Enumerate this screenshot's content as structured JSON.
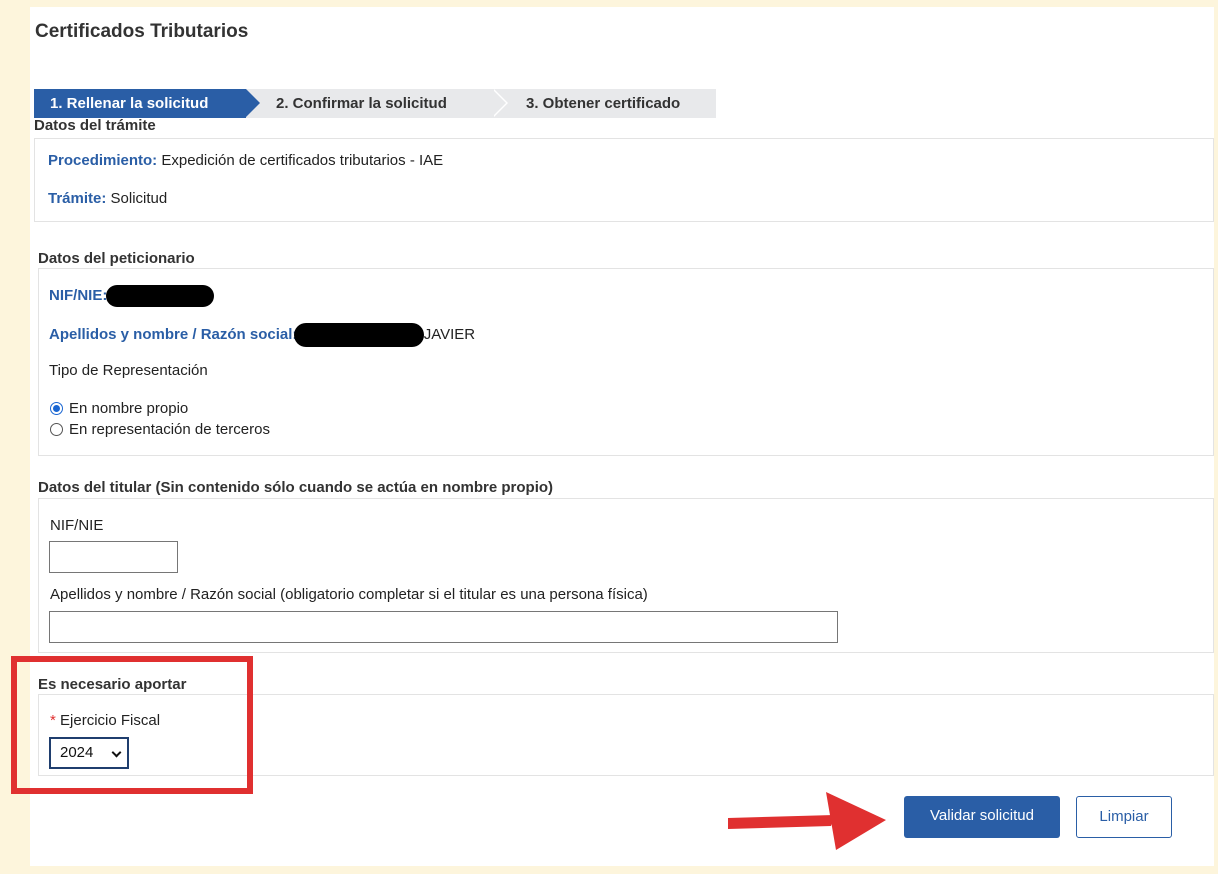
{
  "page": {
    "title": "Certificados Tributarios"
  },
  "steps": [
    {
      "label": "1. Rellenar la solicitud"
    },
    {
      "label": "2. Confirmar la solicitud"
    },
    {
      "label": "3. Obtener certificado"
    }
  ],
  "tramite": {
    "heading": "Datos del trámite",
    "procedimiento_label": "Procedimiento:",
    "procedimiento_value": "Expedición de certificados tributarios - IAE",
    "tramite_label": "Trámite:",
    "tramite_value": "Solicitud"
  },
  "peticionario": {
    "heading": "Datos del peticionario",
    "nif_label": "NIF/NIE:",
    "nombre_label": "Apellidos y nombre / Razón social:",
    "nombre_visible_suffix": "JAVIER",
    "tipo_label": "Tipo de Representación",
    "options": [
      {
        "label": "En nombre propio",
        "checked": true
      },
      {
        "label": "En representación de terceros",
        "checked": false
      }
    ]
  },
  "titular": {
    "heading": "Datos del titular (Sin contenido sólo cuando se actúa en nombre propio)",
    "nif_label": "NIF/NIE",
    "nif_value": "",
    "nombre_label": "Apellidos y nombre / Razón social (obligatorio completar si el titular es una persona física)",
    "nombre_value": ""
  },
  "aportar": {
    "heading": "Es necesario aportar",
    "required_mark": "*",
    "ejercicio_label": "Ejercicio Fiscal",
    "ejercicio_value": "2024"
  },
  "actions": {
    "validate_label": "Validar solicitud",
    "clear_label": "Limpiar"
  },
  "colors": {
    "accent": "#2a5ea6",
    "annotation": "#e03030",
    "background": "#fdf5dc"
  }
}
